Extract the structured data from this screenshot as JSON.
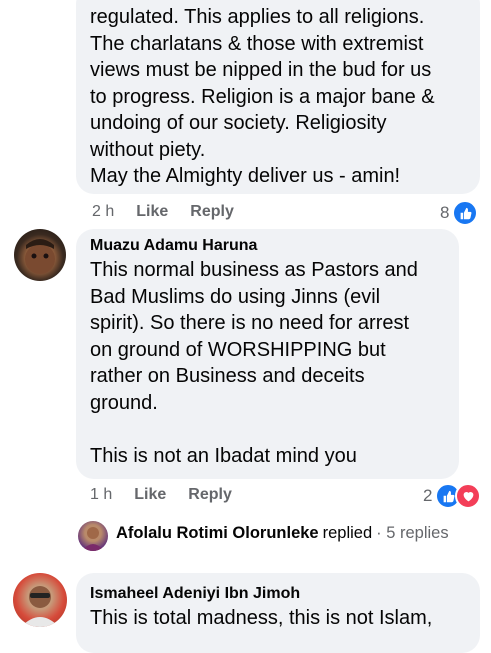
{
  "comment1": {
    "body": "regulated. This applies to all religions.\nThe charlatans & those with extremist\nviews must be nipped in the bud for us\nto progress. Religion is a major bane &\nundoing of our society. Religiosity\nwithout piety.\nMay the Almighty deliver us - amin!",
    "time": "2 h",
    "like": "Like",
    "reply": "Reply",
    "reaction_count": "8",
    "reaction_icons": [
      "like-icon"
    ]
  },
  "comment2": {
    "author": "Muazu Adamu Haruna",
    "body": "This normal business as Pastors and\nBad Muslims do using Jinns (evil\nspirit). So there is no need for arrest\non ground of WORSHIPPING but\nrather on Business and deceits\nground.\n\nThis is not an Ibadat mind you",
    "time": "1 h",
    "like": "Like",
    "reply": "Reply",
    "reaction_count": "2",
    "reaction_icons": [
      "like-icon",
      "love-icon"
    ]
  },
  "reply_summary": {
    "name": "Afolalu Rotimi Olorunleke",
    "verb": "replied",
    "count": "· 5 replies"
  },
  "comment3": {
    "author": "Ismaheel Adeniyi Ibn Jimoh",
    "body": "This is total madness, this is not Islam,"
  },
  "colors": {
    "bubble": "#f0f2f5",
    "like_blue": "#1877f2",
    "love_red": "#f33e58",
    "meta_gray": "#65676b"
  }
}
